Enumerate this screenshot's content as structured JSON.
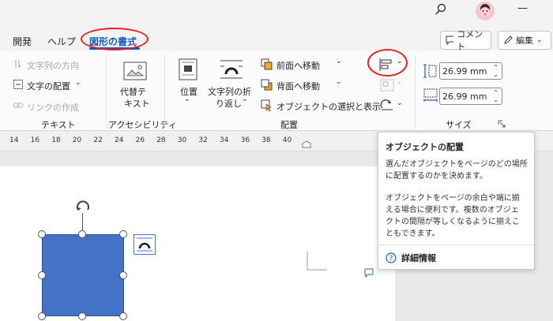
{
  "titlebar": {
    "search_icon": "search-icon",
    "minimize_glyph": "—"
  },
  "tabs": [
    {
      "label": "開発"
    },
    {
      "label": "ヘルプ"
    },
    {
      "label": "図形の書式",
      "active": true
    }
  ],
  "actions": {
    "comment_label": "コメント",
    "edit_label": "編集"
  },
  "ribbon": {
    "text_group": {
      "label": "テキスト",
      "text_direction": "文字列の方向",
      "text_align": "文字の配置",
      "create_link": "リンクの作成"
    },
    "accessibility_group": {
      "label": "アクセシビリティ",
      "alt_text_line1": "代替テ",
      "alt_text_line2": "キスト"
    },
    "arrange_group": {
      "label": "配置",
      "position_line1": "位置",
      "wrap_line1": "文字列の折",
      "wrap_line2": "り返し",
      "bring_forward": "前面へ移動",
      "send_backward": "背面へ移動",
      "selection_pane": "オブジェクトの選択と表示"
    },
    "size_group": {
      "label": "サイズ",
      "height": "26.99 mm",
      "width": "26.99 mm"
    }
  },
  "ruler": {
    "numbers": [
      "14",
      "16",
      "18",
      "20",
      "22",
      "24",
      "26",
      "28",
      "30",
      "32",
      "34",
      "36",
      "38",
      "40"
    ]
  },
  "tooltip": {
    "title": "オブジェクトの配置",
    "para1_line1": "選んだオブジェクトをページのどの場所",
    "para1_line2": "に配置するのかを決めます。",
    "para2_line1": "オブジェクトをページの余白や端に揃",
    "para2_line2": "える場合に便利です。複数のオブジェ",
    "para2_line3": "クトの間隔が等しくなるように揃えこ",
    "para2_line4": "ともできます。",
    "more_info": "詳細情報"
  },
  "colors": {
    "accent": "#185abd",
    "shape_fill": "#4472c4",
    "highlight": "#e8201e"
  }
}
